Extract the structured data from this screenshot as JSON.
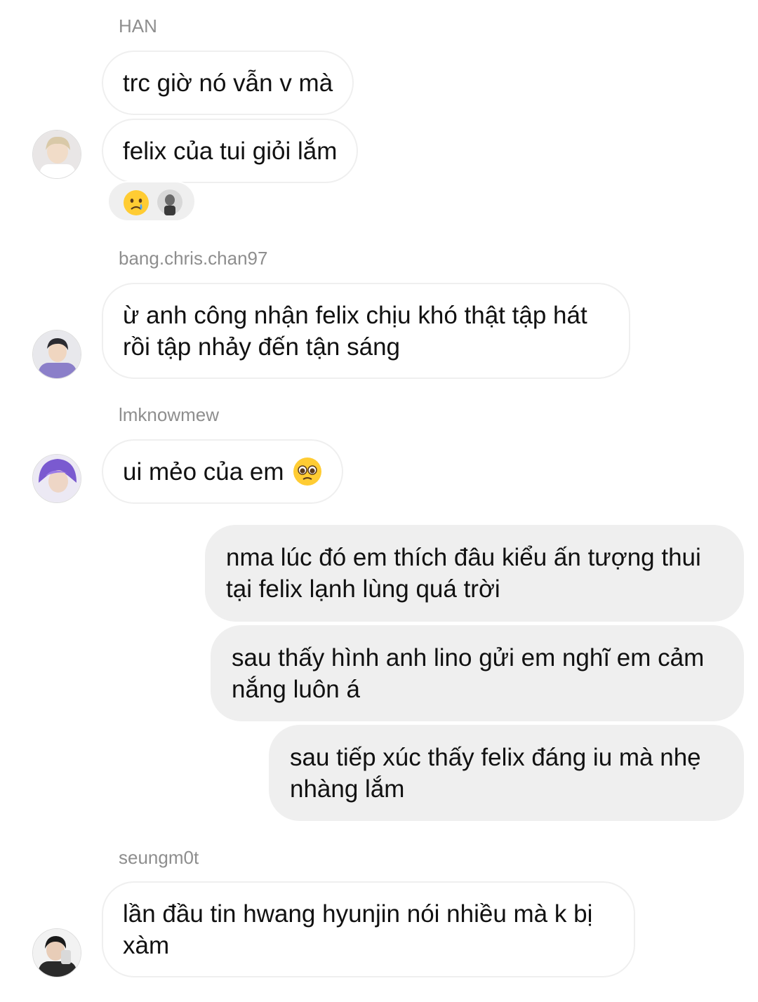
{
  "messages": [
    {
      "sender": "HAN",
      "lines": [
        "trc giờ nó vẫn v mà",
        "felix của tui giỏi lắm"
      ]
    },
    {
      "sender": "bang.chris.chan97",
      "text": "ừ anh công nhận felix chịu khó thật tập hát rồi tập nhảy đến tận sáng"
    },
    {
      "sender": "lmknowmew",
      "text": "ui mẻo của em"
    },
    {
      "outgoing": [
        "nma lúc đó em thích đâu kiểu ấn tượng thui tại felix lạnh lùng quá trời",
        "sau thấy hình anh lino gửi em nghĩ em cảm nắng luôn á",
        "sau tiếp xúc thấy felix đáng iu mà nhẹ nhàng lắm"
      ]
    },
    {
      "sender": "seungm0t",
      "text": "lần đầu tin hwang hyunjin nói nhiều mà k bị xàm"
    }
  ],
  "reaction": {
    "emoji": "crying-face-icon"
  },
  "inline_emoji": "pleading-face-icon",
  "colors": {
    "incoming_border": "#efefef",
    "outgoing_bg": "#efefef",
    "sender_text": "#8e8e8e"
  }
}
